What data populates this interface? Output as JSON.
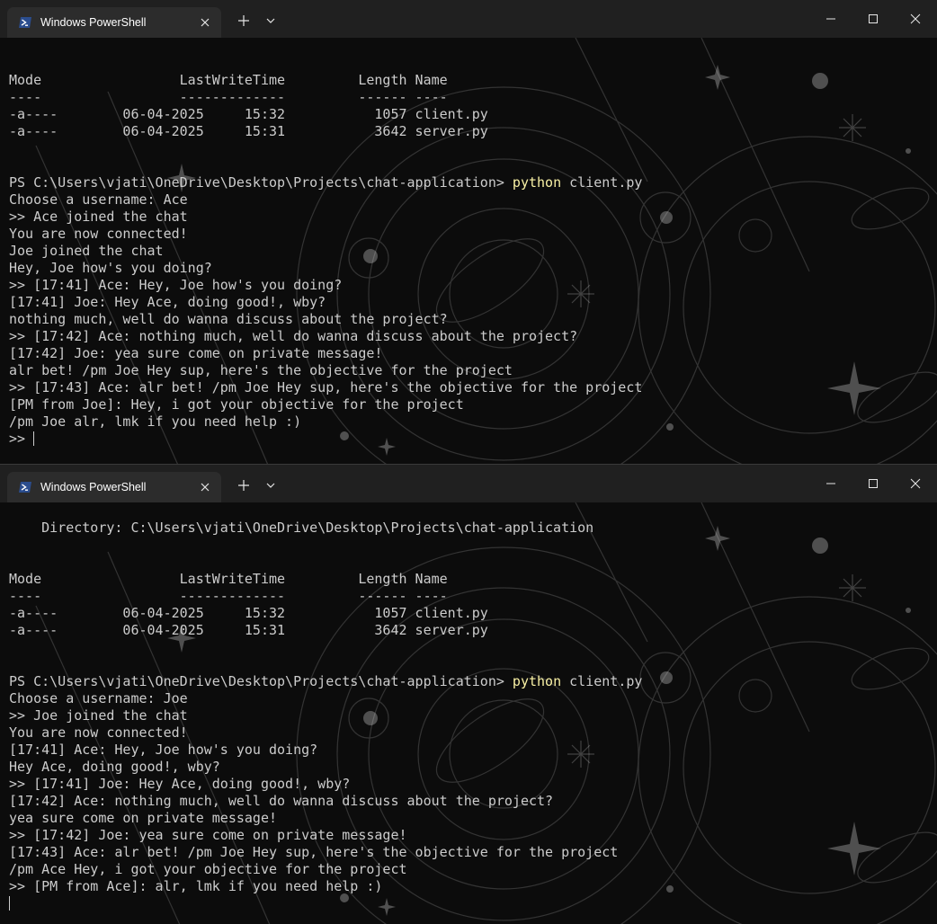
{
  "top_window": {
    "tab_title": "Windows PowerShell",
    "icons": {
      "tab_icon": "powershell-icon",
      "tab_close": "close-icon",
      "new_tab": "plus-icon",
      "dropdown": "chevron-down-icon",
      "minimize": "minimize-icon",
      "maximize": "maximize-icon",
      "close": "close-icon"
    },
    "lines": [
      {
        "text": ""
      },
      {
        "text": ""
      },
      {
        "text": "Mode                 LastWriteTime         Length Name"
      },
      {
        "text": "----                 -------------         ------ ----"
      },
      {
        "text": "-a----        06-04-2025     15:32           1057 client.py"
      },
      {
        "text": "-a----        06-04-2025     15:31           3642 server.py"
      },
      {
        "text": ""
      },
      {
        "text": ""
      },
      {
        "prompt": "PS C:\\Users\\vjati\\OneDrive\\Desktop\\Projects\\chat-application> ",
        "command": "python",
        "args": " client.py"
      },
      {
        "text": "Choose a username: Ace"
      },
      {
        "text": ">> Ace joined the chat"
      },
      {
        "text": "You are now connected!"
      },
      {
        "text": "Joe joined the chat"
      },
      {
        "text": "Hey, Joe how's you doing?"
      },
      {
        "text": ">> [17:41] Ace: Hey, Joe how's you doing?"
      },
      {
        "text": "[17:41] Joe: Hey Ace, doing good!, wby?"
      },
      {
        "text": "nothing much, well do wanna discuss about the project?"
      },
      {
        "text": ">> [17:42] Ace: nothing much, well do wanna discuss about the project?"
      },
      {
        "text": "[17:42] Joe: yea sure come on private message!"
      },
      {
        "text": "alr bet! /pm Joe Hey sup, here's the objective for the project"
      },
      {
        "text": ">> [17:43] Ace: alr bet! /pm Joe Hey sup, here's the objective for the project"
      },
      {
        "text": "[PM from Joe]: Hey, i got your objective for the project"
      },
      {
        "text": "/pm Joe alr, lmk if you need help :)"
      },
      {
        "text": ">> ",
        "cursor": true
      }
    ]
  },
  "bottom_window": {
    "tab_title": "Windows PowerShell",
    "lines": [
      {
        "text": ""
      },
      {
        "text": "    Directory: C:\\Users\\vjati\\OneDrive\\Desktop\\Projects\\chat-application"
      },
      {
        "text": ""
      },
      {
        "text": ""
      },
      {
        "text": "Mode                 LastWriteTime         Length Name"
      },
      {
        "text": "----                 -------------         ------ ----"
      },
      {
        "text": "-a----        06-04-2025     15:32           1057 client.py"
      },
      {
        "text": "-a----        06-04-2025     15:31           3642 server.py"
      },
      {
        "text": ""
      },
      {
        "text": ""
      },
      {
        "prompt": "PS C:\\Users\\vjati\\OneDrive\\Desktop\\Projects\\chat-application> ",
        "command": "python",
        "args": " client.py"
      },
      {
        "text": "Choose a username: Joe"
      },
      {
        "text": ">> Joe joined the chat"
      },
      {
        "text": "You are now connected!"
      },
      {
        "text": "[17:41] Ace: Hey, Joe how's you doing?"
      },
      {
        "text": "Hey Ace, doing good!, wby?"
      },
      {
        "text": ">> [17:41] Joe: Hey Ace, doing good!, wby?"
      },
      {
        "text": "[17:42] Ace: nothing much, well do wanna discuss about the project?"
      },
      {
        "text": "yea sure come on private message!"
      },
      {
        "text": ">> [17:42] Joe: yea sure come on private message!"
      },
      {
        "text": "[17:43] Ace: alr bet! /pm Joe Hey sup, here's the objective for the project"
      },
      {
        "text": "/pm Ace Hey, i got your objective for the project"
      },
      {
        "text": ">> [PM from Ace]: alr, lmk if you need help :)"
      },
      {
        "text": "",
        "cursor": true
      }
    ]
  },
  "colors": {
    "titlebar": "#202020",
    "active_tab": "#2c2c2c",
    "terminal_bg": "#0c0c0c",
    "terminal_text": "#cccccc",
    "command_text": "#f9f1a5",
    "powershell_blue": "#2b4d8e"
  }
}
